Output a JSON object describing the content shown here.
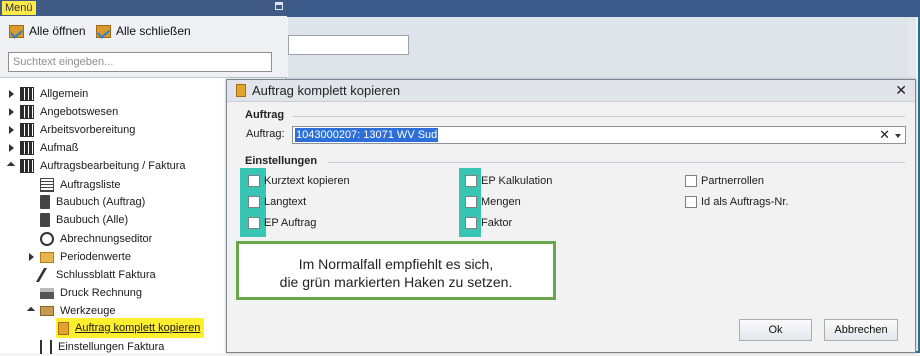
{
  "menu": {
    "title": "Menü",
    "open_all": "Alle öffnen",
    "close_all": "Alle schließen",
    "search_placeholder": "Suchtext eingeben...",
    "items": [
      {
        "label": "Allgemein"
      },
      {
        "label": "Angebotswesen"
      },
      {
        "label": "Arbeitsvorbereitung"
      },
      {
        "label": "Aufmaß"
      },
      {
        "label": "Auftragsbearbeitung / Faktura"
      },
      {
        "label": "Auftragsliste"
      },
      {
        "label": "Baubuch (Auftrag)"
      },
      {
        "label": "Baubuch (Alle)"
      },
      {
        "label": "Abrechnungseditor"
      },
      {
        "label": "Periodenwerte"
      },
      {
        "label": "Schlussblatt Faktura"
      },
      {
        "label": "Druck Rechnung"
      },
      {
        "label": "Werkzeuge"
      },
      {
        "label": "Auftrag komplett kopieren"
      },
      {
        "label": "Einstellungen Faktura"
      }
    ]
  },
  "dialog": {
    "title": "Auftrag komplett kopieren",
    "section_auftrag": "Auftrag",
    "auftrag_label": "Auftrag:",
    "auftrag_value": "1043000207: 13071 WV Sud",
    "section_einstellungen": "Einstellungen",
    "checkboxes": [
      {
        "label": "Kurztext kopieren"
      },
      {
        "label": "Langtext"
      },
      {
        "label": "EP Auftrag"
      },
      {
        "label": "EP Kalkulation"
      },
      {
        "label": "Mengen"
      },
      {
        "label": "Faktor"
      },
      {
        "label": "Partnerrollen"
      },
      {
        "label": "Id als Auftrags-Nr."
      }
    ],
    "ok_label": "Ok",
    "cancel_label": "Abbrechen"
  },
  "note": {
    "line1": "Im Normalfall empfiehlt es sich,",
    "line2": "die grün markierten Haken zu setzen."
  },
  "colors": {
    "highlight_yellow": "#ffef2e",
    "green_mark": "#39c5b4",
    "note_border": "#6aa64a",
    "selection_blue": "#2d6fd8"
  }
}
